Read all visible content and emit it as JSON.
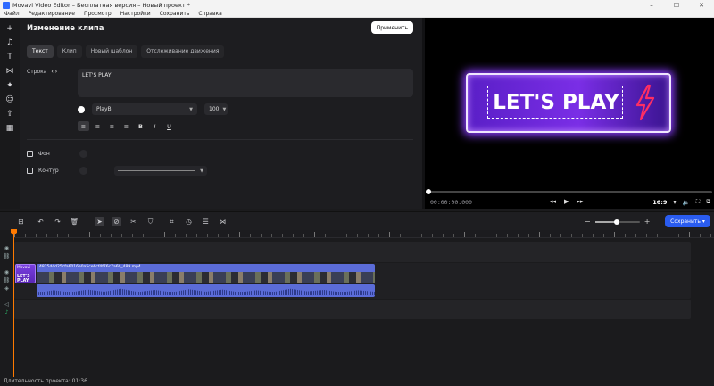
{
  "window": {
    "title": "Movavi Video Editor – Бесплатная версия – Новый проект *",
    "controls": [
      "–",
      "☐",
      "✕"
    ]
  },
  "menu": [
    "Файл",
    "Редактирование",
    "Просмотр",
    "Настройки",
    "Сохранить",
    "Справка"
  ],
  "left_toolbar": [
    "plus-icon",
    "music-note-icon",
    "text-icon",
    "transitions-icon",
    "magic-wand-icon",
    "stickers-icon",
    "export-icon",
    "more-icon"
  ],
  "editor": {
    "heading": "Изменение клипа",
    "apply_label": "Применить",
    "tabs": [
      {
        "label": "Текст",
        "active": true
      },
      {
        "label": "Клип",
        "active": false
      },
      {
        "label": "Новый шаблон",
        "active": false
      },
      {
        "label": "Отслеживание движения",
        "active": false
      }
    ],
    "row_label": "Строка",
    "row_arrows": "‹ ›",
    "text_value": "LET'S PLAY",
    "font_color": "#ffffff",
    "font_name": "PlayB",
    "font_size": "100",
    "format_buttons": [
      {
        "glyph": "≡",
        "name": "align-left-icon",
        "active": true
      },
      {
        "glyph": "≡",
        "name": "align-center-icon",
        "active": false
      },
      {
        "glyph": "≡",
        "name": "align-right-icon",
        "active": false
      },
      {
        "glyph": "≡",
        "name": "align-justify-icon",
        "active": false
      },
      {
        "glyph": "B",
        "name": "bold-icon",
        "active": false
      },
      {
        "glyph": "I",
        "name": "italic-icon",
        "active": false
      },
      {
        "glyph": "U",
        "name": "underline-icon",
        "active": false
      }
    ],
    "background_label": "Фон",
    "outline_label": "Контур"
  },
  "preview": {
    "overlay_text": "LET'S PLAY",
    "timecode": "00:00:00.000",
    "progress": 0.0,
    "aspect_ratio": "16:9",
    "colors": {
      "card": "#7a2ee6",
      "glow": "#8a3cff",
      "bolt": "#ff2e63"
    }
  },
  "timeline": {
    "save_label": "Сохранить",
    "zoom_level": 0.48,
    "title_clip": {
      "label1": "Movavi",
      "label2": "LET'S PLAY"
    },
    "video_clip": {
      "filename": "4825d4d25cfa6016a0a5ce6cf4f76c7a6b_489.mp4"
    },
    "playhead_color": "#ff7a00"
  },
  "status": {
    "duration": "Длительность проекта: 01:36"
  }
}
